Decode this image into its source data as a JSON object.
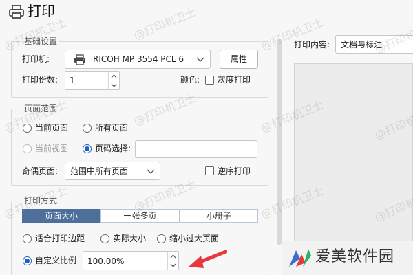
{
  "window": {
    "title": "打印"
  },
  "basic": {
    "legend": "基础设置",
    "printer_label": "打印机:",
    "printer_value": "RICOH MP 3554 PCL 6",
    "properties_button": "属性",
    "copies_label": "打印份数:",
    "copies_value": "1",
    "color_label": "颜色:",
    "grayscale_label": "灰度打印"
  },
  "range": {
    "legend": "页面范围",
    "current_page": "当前页面",
    "all_pages": "所有页面",
    "current_view": "当前视图",
    "page_select": "页码选择:",
    "page_select_value": "",
    "odd_even_label": "奇偶页面:",
    "odd_even_value": "范围中所有页面",
    "reverse_label": "逆序打印"
  },
  "method": {
    "legend": "打印方式",
    "tabs": [
      "页面大小",
      "一张多页",
      "小册子"
    ],
    "fit_margins": "适合打印边距",
    "actual_size": "实际大小",
    "shrink_oversized": "缩小过大页面",
    "custom_scale": "自定义比例",
    "scale_value": "100.00%"
  },
  "content": {
    "label": "打印内容:",
    "value": "文档与标注"
  },
  "watermark_text": "@打印机卫士",
  "brand": {
    "name": "爱美软件园"
  },
  "colors": {
    "accent": "#1f5fbf",
    "tab_active": "#4d6f99",
    "arrow": "#e8383d"
  }
}
